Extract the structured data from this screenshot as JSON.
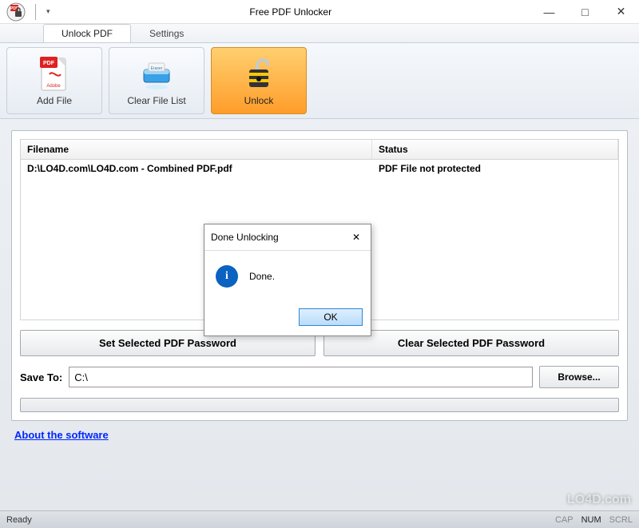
{
  "window": {
    "title": "Free PDF Unlocker",
    "minimize": "—",
    "maximize": "□",
    "close": "✕"
  },
  "tabs": {
    "unlock": "Unlock PDF",
    "settings": "Settings"
  },
  "ribbon": {
    "add_file": "Add File",
    "clear_list": "Clear File List",
    "unlock": "Unlock"
  },
  "table": {
    "col_filename": "Filename",
    "col_status": "Status",
    "rows": [
      {
        "filename": "D:\\LO4D.com\\LO4D.com - Combined PDF.pdf",
        "status": "PDF File not protected"
      }
    ]
  },
  "buttons": {
    "set_password": "Set Selected PDF Password",
    "clear_password": "Clear Selected PDF Password",
    "browse": "Browse..."
  },
  "save": {
    "label": "Save To:",
    "value": "C:\\"
  },
  "link": {
    "about": "About the software"
  },
  "statusbar": {
    "ready": "Ready",
    "cap": "CAP",
    "num": "NUM",
    "scrl": "SCRL"
  },
  "dialog": {
    "title": "Done Unlocking",
    "message": "Done.",
    "ok": "OK",
    "close": "✕"
  },
  "watermark": "LO4D.com"
}
